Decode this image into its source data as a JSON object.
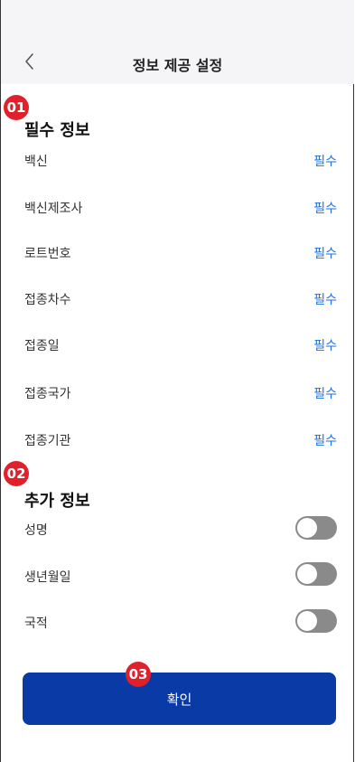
{
  "header": {
    "title": "정보 제공 설정",
    "back_icon": "chevron-left-icon"
  },
  "markers": [
    "01",
    "02",
    "03"
  ],
  "required_section": {
    "title": "필수 정보",
    "items": [
      {
        "label": "백신",
        "tag": "필수"
      },
      {
        "label": "백신제조사",
        "tag": "필수"
      },
      {
        "label": "로트번호",
        "tag": "필수"
      },
      {
        "label": "접종차수",
        "tag": "필수"
      },
      {
        "label": "접종일",
        "tag": "필수"
      },
      {
        "label": "접종국가",
        "tag": "필수"
      },
      {
        "label": "접종기관",
        "tag": "필수"
      }
    ]
  },
  "optional_section": {
    "title": "추가 정보",
    "items": [
      {
        "label": "성명",
        "enabled": false
      },
      {
        "label": "생년월일",
        "enabled": false
      },
      {
        "label": "국적",
        "enabled": false
      }
    ]
  },
  "confirm_label": "확인",
  "colors": {
    "accent": "#0a3aa6",
    "required_tag": "#1e6fd9",
    "marker": "#e0212b",
    "toggle_off": "#8a8a8a"
  }
}
